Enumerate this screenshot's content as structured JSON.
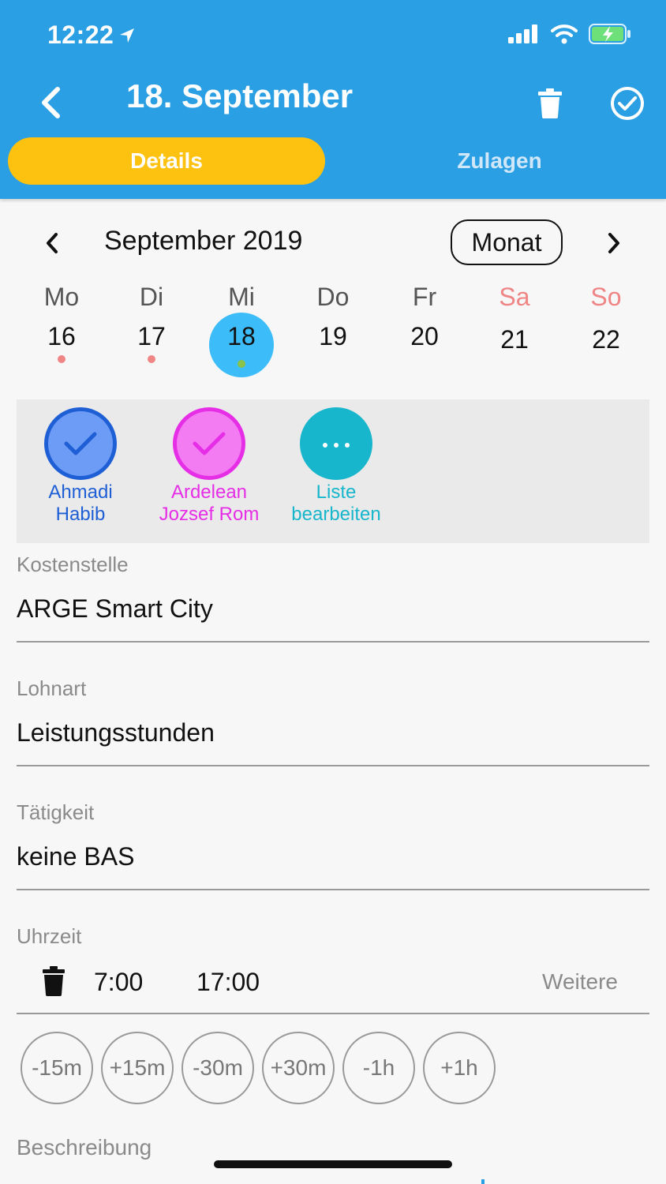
{
  "status": {
    "time": "12:22"
  },
  "header": {
    "title": "18. September"
  },
  "tabs": [
    {
      "label": "Details",
      "active": true
    },
    {
      "label": "Zulagen",
      "active": false
    }
  ],
  "calendar": {
    "month": "September 2019",
    "format_button": "Monat",
    "selected_day": "18",
    "days": [
      {
        "name": "Mo",
        "num": "16",
        "weekend": false,
        "marker": true
      },
      {
        "name": "Di",
        "num": "17",
        "weekend": false,
        "marker": true
      },
      {
        "name": "Mi",
        "num": "18",
        "weekend": false,
        "marker": true
      },
      {
        "name": "Do",
        "num": "19",
        "weekend": false,
        "marker": false
      },
      {
        "name": "Fr",
        "num": "20",
        "weekend": false,
        "marker": false
      },
      {
        "name": "Sa",
        "num": "21",
        "weekend": true,
        "marker": false
      },
      {
        "name": "So",
        "num": "22",
        "weekend": true,
        "marker": false
      }
    ]
  },
  "workers": [
    {
      "line1": "Ahmadi",
      "line2": "Habib",
      "color": "#1f5fd6"
    },
    {
      "line1": "Ardelean",
      "line2": "Jozsef Rom",
      "color": "#e62ee6"
    },
    {
      "line1": "Liste",
      "line2": "bearbeiten",
      "color": "#17b6cc"
    }
  ],
  "fields": {
    "kostenstelle": {
      "label": "Kostenstelle",
      "value": "ARGE Smart City"
    },
    "lohnart": {
      "label": "Lohnart",
      "value": "Leistungsstunden"
    },
    "taetigkeit": {
      "label": "Tätigkeit",
      "value": "keine BAS"
    },
    "uhrzeit": {
      "label": "Uhrzeit",
      "start": "7:00",
      "end": "17:00",
      "more": "Weitere"
    }
  },
  "adjustments": [
    "-15m",
    "+15m",
    "-30m",
    "+30m",
    "-1h",
    "+1h"
  ],
  "description": {
    "label": "Beschreibung"
  },
  "colors": {
    "appbar": "#2b9fe3",
    "active_tab": "#fdc110",
    "selected_day": "#3cbcf8",
    "weekend": "#ef8585"
  }
}
